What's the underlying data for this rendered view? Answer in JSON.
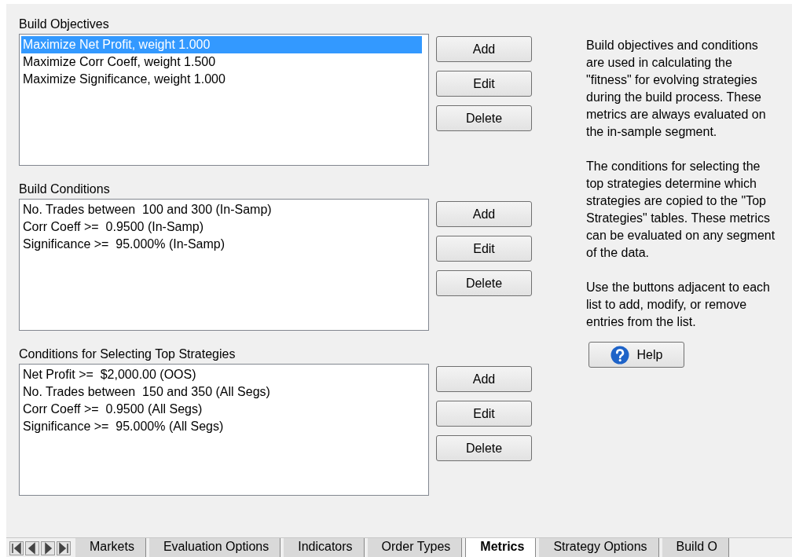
{
  "sections": [
    {
      "label": "Build Objectives",
      "items": [
        {
          "text": "Maximize Net Profit, weight 1.000",
          "selected": true
        },
        {
          "text": "Maximize Corr Coeff, weight 1.500",
          "selected": false
        },
        {
          "text": "Maximize Significance, weight 1.000",
          "selected": false
        }
      ],
      "buttons": [
        "Add",
        "Edit",
        "Delete"
      ]
    },
    {
      "label": "Build Conditions",
      "items": [
        {
          "text": "No. Trades between  100 and 300 (In-Samp)",
          "selected": false
        },
        {
          "text": "Corr Coeff >=  0.9500 (In-Samp)",
          "selected": false
        },
        {
          "text": "Significance >=  95.000% (In-Samp)",
          "selected": false
        }
      ],
      "buttons": [
        "Add",
        "Edit",
        "Delete"
      ]
    },
    {
      "label": "Conditions for Selecting Top Strategies",
      "items": [
        {
          "text": "Net Profit >=  $2,000.00 (OOS)",
          "selected": false
        },
        {
          "text": "No. Trades between  150 and 350 (All Segs)",
          "selected": false
        },
        {
          "text": "Corr Coeff >=  0.9500 (All Segs)",
          "selected": false
        },
        {
          "text": "Significance >=  95.000% (All Segs)",
          "selected": false
        }
      ],
      "buttons": [
        "Add",
        "Edit",
        "Delete"
      ]
    }
  ],
  "help_text": [
    "Build objectives and conditions are used in calculating the \"fitness\" for evolving strategies during the build process. These metrics are always evaluated on the in-sample segment.",
    "The conditions for selecting the top strategies determine which strategies are copied to the \"Top Strategies\" tables. These metrics can be evaluated on any segment of the data.",
    "Use the buttons adjacent to each list to add, modify, or remove entries from the list."
  ],
  "help_button": "Help",
  "tabs": [
    {
      "label": "Markets",
      "selected": false
    },
    {
      "label": "Evaluation Options",
      "selected": false
    },
    {
      "label": "Indicators",
      "selected": false
    },
    {
      "label": "Order Types",
      "selected": false
    },
    {
      "label": "Metrics",
      "selected": true
    },
    {
      "label": "Strategy Options",
      "selected": false
    },
    {
      "label": "Build O",
      "selected": false
    }
  ]
}
